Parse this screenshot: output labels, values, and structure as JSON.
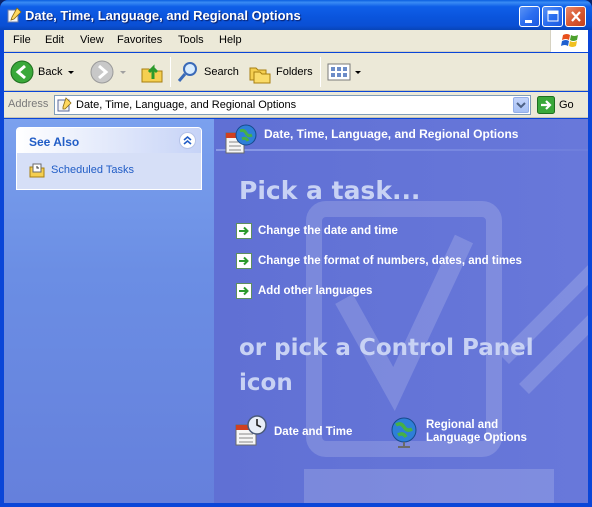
{
  "window": {
    "title": "Date, Time, Language, and Regional Options"
  },
  "menu": {
    "items": [
      "File",
      "Edit",
      "View",
      "Favorites",
      "Tools",
      "Help"
    ]
  },
  "toolbar": {
    "back_label": "Back",
    "search_label": "Search",
    "folders_label": "Folders"
  },
  "address": {
    "label": "Address",
    "value": "Date, Time, Language, and Regional Options",
    "go_label": "Go"
  },
  "sidebar": {
    "see_also_title": "See Also",
    "items": [
      {
        "label": "Scheduled Tasks",
        "icon": "scheduled-tasks-icon"
      }
    ]
  },
  "main": {
    "header_title": "Date, Time, Language, and Regional Options",
    "pick_task_heading": "Pick a task...",
    "tasks": [
      {
        "label": "Change the date and time"
      },
      {
        "label": "Change the format of numbers, dates, and times"
      },
      {
        "label": "Add other languages"
      }
    ],
    "or_pick_heading": "or pick a Control Panel icon",
    "icons": [
      {
        "label": "Date and Time",
        "icon": "date-time-icon"
      },
      {
        "label_line1": "Regional and",
        "label_line2": "Language Options",
        "icon": "globe-icon"
      }
    ]
  },
  "colors": {
    "titlebar": "#0a54dc",
    "chrome": "#ece9d8",
    "content_bg": "#6375d6",
    "link": "#215dc6"
  }
}
